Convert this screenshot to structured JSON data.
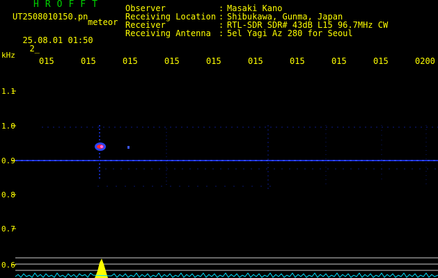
{
  "header": {
    "app_title": "HROFFT",
    "file_name": "UT2508010150.pn",
    "file_type": "meteor",
    "date_time": "25.08.01 01:50",
    "sequence": "2_"
  },
  "station": {
    "rows": [
      {
        "label": "Observer",
        "value": "Masaki Kano"
      },
      {
        "label": "Receiving Location",
        "value": "Shibukawa, Gunma, Japan"
      },
      {
        "label": "Receiver",
        "value": "RTL-SDR SDR# 43dB L15 96.7MHz CW"
      },
      {
        "label": "Receiving Antenna",
        "value": "5el Yagi Az 280 for Seoul"
      }
    ],
    "separator": ":"
  },
  "y_axis": {
    "unit": "kHz",
    "ticks": [
      "1.1",
      "1.0",
      "0.9",
      "0.8",
      "0.7",
      "0.6"
    ]
  },
  "x_axis": {
    "ticks": [
      "015",
      "015",
      "015",
      "015",
      "015",
      "015",
      "015",
      "015",
      "015",
      "0200"
    ]
  },
  "colors": {
    "text": "#ffff00",
    "title": "#00d000",
    "background": "#000000",
    "carrier": "#2244ff",
    "meteor_echo": "#ff2222",
    "spectrum_trace": "#00e0ff",
    "spectrum_peak": "#ffff00"
  }
}
